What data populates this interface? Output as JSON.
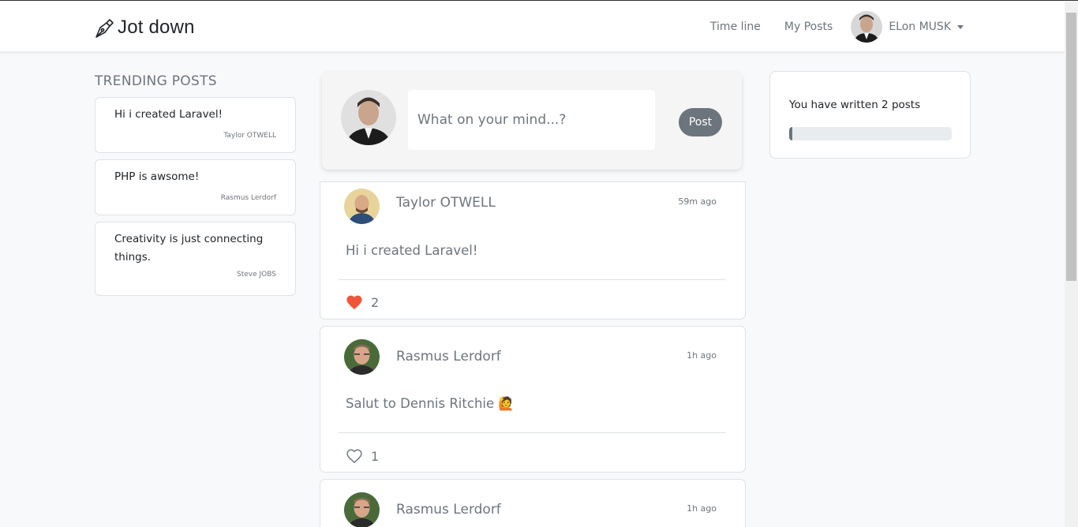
{
  "app": {
    "brand": "Jot down"
  },
  "nav": {
    "links": [
      "Time line",
      "My Posts"
    ],
    "user_name": "ELon MUSK"
  },
  "trending": {
    "title": "TRENDING POSTS",
    "posts": [
      {
        "text": "Hi i created Laravel!",
        "author": "Taylor OTWELL"
      },
      {
        "text": "PHP is awsome!",
        "author": "Rasmus Lerdorf"
      },
      {
        "text": "Creativity is just connecting things.",
        "author": "Steve JOBS"
      }
    ]
  },
  "composer": {
    "placeholder": "What on your mind...?",
    "button_label": "Post"
  },
  "feed": [
    {
      "author": "Taylor OTWELL",
      "time": "59m ago",
      "body": "Hi i created Laravel!",
      "likes": "2",
      "liked": true
    },
    {
      "author": "Rasmus Lerdorf",
      "time": "1h ago",
      "body": "Salut to Dennis Ritchie 🙋",
      "likes": "1",
      "liked": false
    },
    {
      "author": "Rasmus Lerdorf",
      "time": "1h ago",
      "body": "",
      "likes": "",
      "liked": false
    }
  ],
  "stats": {
    "text": "You have written 2 posts",
    "progress_percent": 2
  },
  "colors": {
    "accent": "#6c757d",
    "like": "#f0553a"
  }
}
